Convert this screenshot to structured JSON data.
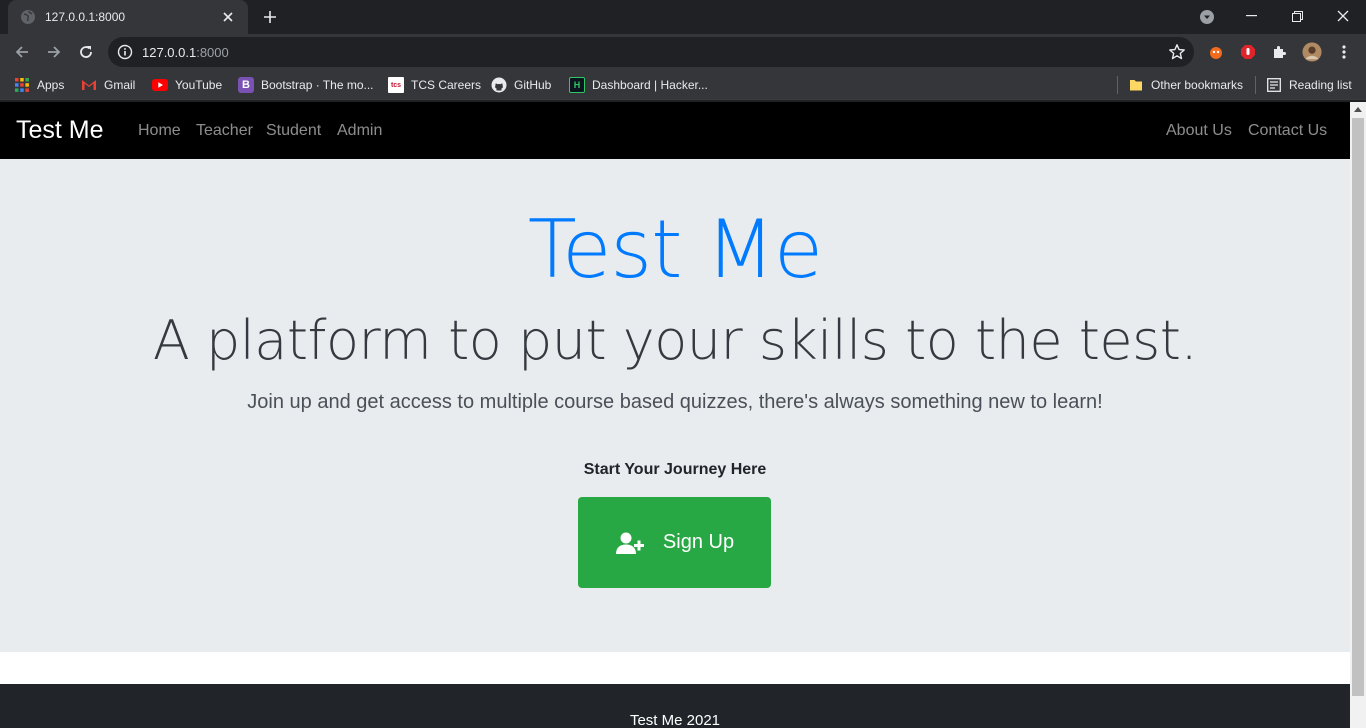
{
  "browser": {
    "tab_title": "127.0.0.1:8000",
    "url_host": "127.0.0.1",
    "url_port": ":8000",
    "bookmarks": [
      {
        "label": "Apps",
        "icon": "apps-grid-icon"
      },
      {
        "label": "Gmail",
        "icon": "gmail-icon"
      },
      {
        "label": "YouTube",
        "icon": "youtube-icon"
      },
      {
        "label": "Bootstrap · The mo...",
        "icon": "bootstrap-icon"
      },
      {
        "label": "TCS Careers",
        "icon": "tcs-icon"
      },
      {
        "label": "GitHub",
        "icon": "github-icon"
      },
      {
        "label": "Dashboard | Hacker...",
        "icon": "hackerrank-icon"
      }
    ],
    "other_bookmarks": "Other bookmarks",
    "reading_list": "Reading list"
  },
  "navbar": {
    "brand": "Test Me",
    "links": [
      "Home",
      "Teacher",
      "Student",
      "Admin"
    ],
    "right_links": [
      "About Us",
      "Contact Us"
    ]
  },
  "hero": {
    "title": "Test Me",
    "subtitle": "A platform to put your skills to the test.",
    "lead": "Join up and get access to multiple course based quizzes, there's always something new to learn!",
    "cta_heading": "Start Your Journey Here",
    "signup_label": "Sign Up"
  },
  "footer": {
    "text": "Test Me 2021"
  },
  "colors": {
    "primary": "#007bff",
    "success": "#28a745",
    "jumbotron_bg": "#e9ecef",
    "footer_bg": "#212529"
  }
}
